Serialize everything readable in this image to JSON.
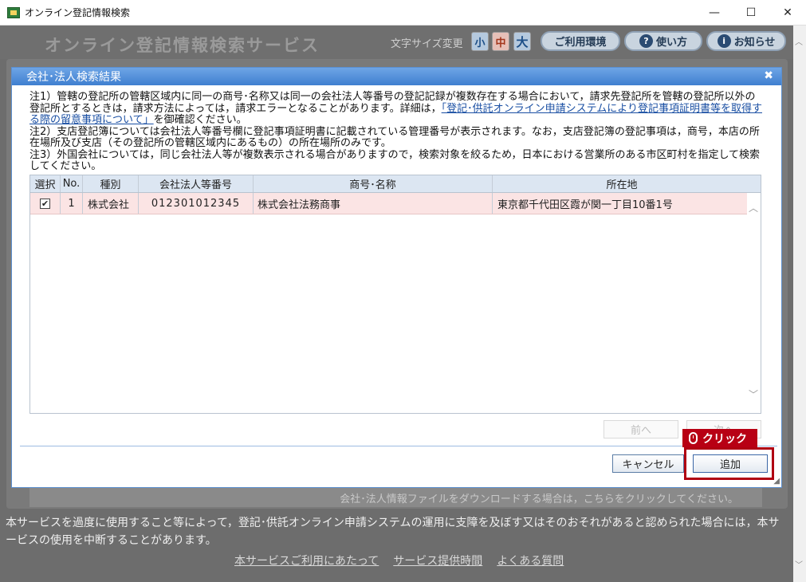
{
  "window": {
    "title": "オンライン登記情報検索",
    "minimize": "—",
    "maximize": "☐",
    "close": "✕"
  },
  "header": {
    "service_title": "オンライン登記情報検索サービス",
    "font_size_label": "文字サイズ変更",
    "font_small": "小",
    "font_medium": "中",
    "font_large": "大",
    "env_button": "ご利用環境",
    "howto_button": "使い方",
    "howto_icon": "?",
    "news_button": "お知らせ",
    "news_icon": "i"
  },
  "dialog": {
    "title": "会社･法人検索結果",
    "close_icon": "✖",
    "notes": {
      "note1_a": "注1）管轄の登記所の管轄区域内に同一の商号･名称又は同一の会社法人等番号の登記記録が複数存在する場合において，請求先登記所を管轄の登記所以外の登記所とするときは，請求方法によっては，請求エラーとなることがあります。詳細は，",
      "note1_link": "「登記･供託オンライン申請システムにより登記事項証明書等を取得する際の留意事項について」",
      "note1_b": "を御確認ください。",
      "note2": "注2）支店登記簿については会社法人等番号欄に登記事項証明書に記載されている管理番号が表示されます。なお，支店登記簿の登記事項は，商号，本店の所在場所及び支店（その登記所の管轄区域内にあるもの）の所在場所のみです。",
      "note3": "注3）外国会社については，同じ会社法人等が複数表示される場合がありますので，検索対象を絞るため，日本における営業所のある市区町村を指定して検索してください。"
    },
    "table": {
      "columns": [
        "選択",
        "No.",
        "種別",
        "会社法人等番号",
        "商号･名称",
        "所在地"
      ],
      "rows": [
        {
          "selected": "✔",
          "no": "1",
          "type": "株式会社",
          "number": "012301012345",
          "name": "株式会社法務商事",
          "address": "東京都千代田区霞が関一丁目10番1号"
        }
      ]
    },
    "prev_button": "前へ",
    "next_button": "次へ",
    "cancel_button": "キャンセル",
    "add_button": "追加",
    "click_tag": "クリック"
  },
  "background": {
    "download_text": "会社･法人情報ファイルをダウンロードする場合は，こちらをクリックしてください。",
    "notice": "本サービスを過度に使用すること等によって，登記･供託オンライン申請システムの運用に支障を及ぼす又はそのおそれがあると認められた場合には，本サービスの使用を中断することがあります。",
    "links": [
      "本サービスご利用にあたって",
      "サービス提供時間",
      "よくある質問"
    ]
  }
}
